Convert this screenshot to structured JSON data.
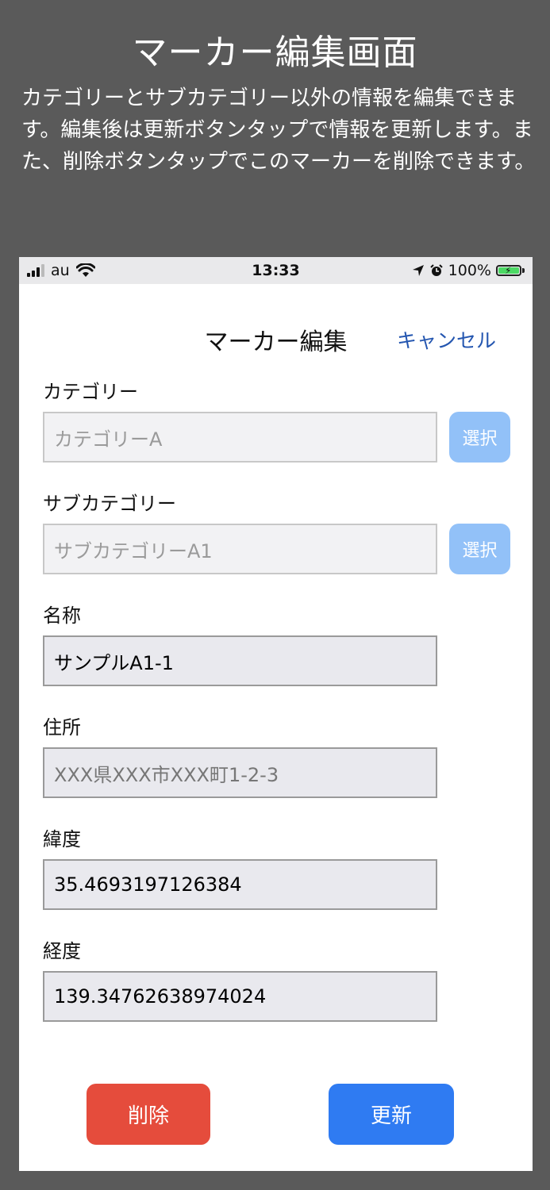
{
  "header": {
    "title": "マーカー編集画面",
    "description": "カテゴリーとサブカテゴリー以外の情報を編集できます。編集後は更新ボタンタップで情報を更新します。また、削除ボタンタップでこのマーカーを削除できます。"
  },
  "status_bar": {
    "carrier": "au",
    "time": "13:33",
    "battery": "100%"
  },
  "nav": {
    "title": "マーカー編集",
    "cancel_label": "キャンセル"
  },
  "form": {
    "category": {
      "label": "カテゴリー",
      "value": "カテゴリーA",
      "button": "選択"
    },
    "subcategory": {
      "label": "サブカテゴリー",
      "value": "サブカテゴリーA1",
      "button": "選択"
    },
    "name": {
      "label": "名称",
      "value": "サンプルA1-1"
    },
    "address": {
      "label": "住所",
      "placeholder": "XXX県XXX市XXX町1-2-3"
    },
    "latitude": {
      "label": "緯度",
      "value": "35.4693197126384"
    },
    "longitude": {
      "label": "経度",
      "value": "139.34762638974024"
    }
  },
  "actions": {
    "delete_label": "削除",
    "update_label": "更新"
  },
  "colors": {
    "background": "#5a5a5a",
    "link": "#2456b0",
    "select_button": "#92c1f8",
    "delete_button": "#e54c3c",
    "update_button": "#2f7bf2"
  }
}
